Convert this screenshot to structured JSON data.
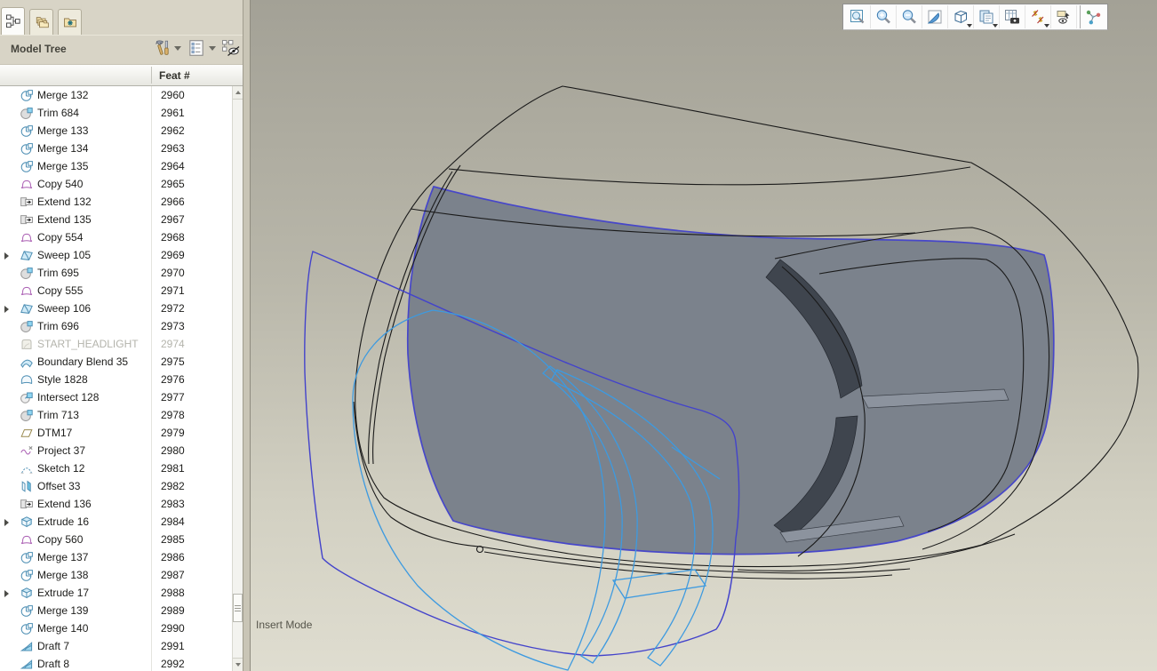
{
  "left_panel": {
    "title": "Model Tree",
    "feat_column_label": "Feat #",
    "tabs": [
      {
        "name": "model-tree",
        "icon": "model-tree-tab-icon",
        "active": true
      },
      {
        "name": "folder-browser",
        "icon": "folder-browser-icon",
        "active": false
      },
      {
        "name": "favorites",
        "icon": "favorites-folder-icon",
        "active": false
      }
    ],
    "header_tools": [
      {
        "name": "tree-filters",
        "icon": "hammer-tools-icon",
        "caret": true
      },
      {
        "name": "tree-display-options",
        "icon": "list-options-icon",
        "caret": true
      },
      {
        "name": "tree-column-settings",
        "icon": "tree-eye-icon",
        "caret": false
      }
    ],
    "rows": [
      {
        "label": "Merge 132",
        "feat": "2960",
        "icon": "merge",
        "expandable": false,
        "dim": false
      },
      {
        "label": "Trim 684",
        "feat": "2961",
        "icon": "trim",
        "expandable": false,
        "dim": false
      },
      {
        "label": "Merge 133",
        "feat": "2962",
        "icon": "merge",
        "expandable": false,
        "dim": false
      },
      {
        "label": "Merge 134",
        "feat": "2963",
        "icon": "merge",
        "expandable": false,
        "dim": false
      },
      {
        "label": "Merge 135",
        "feat": "2964",
        "icon": "merge",
        "expandable": false,
        "dim": false
      },
      {
        "label": "Copy 540",
        "feat": "2965",
        "icon": "copy",
        "expandable": false,
        "dim": false
      },
      {
        "label": "Extend 132",
        "feat": "2966",
        "icon": "extend",
        "expandable": false,
        "dim": false
      },
      {
        "label": "Extend 135",
        "feat": "2967",
        "icon": "extend",
        "expandable": false,
        "dim": false
      },
      {
        "label": "Copy 554",
        "feat": "2968",
        "icon": "copy",
        "expandable": false,
        "dim": false
      },
      {
        "label": "Sweep 105",
        "feat": "2969",
        "icon": "sweep",
        "expandable": true,
        "dim": false
      },
      {
        "label": "Trim 695",
        "feat": "2970",
        "icon": "trim",
        "expandable": false,
        "dim": false
      },
      {
        "label": "Copy 555",
        "feat": "2971",
        "icon": "copy",
        "expandable": false,
        "dim": false
      },
      {
        "label": "Sweep 106",
        "feat": "2972",
        "icon": "sweep",
        "expandable": true,
        "dim": false
      },
      {
        "label": "Trim 696",
        "feat": "2973",
        "icon": "trim",
        "expandable": false,
        "dim": false
      },
      {
        "label": "START_HEADLIGHT",
        "feat": "2974",
        "icon": "flag",
        "expandable": false,
        "dim": true
      },
      {
        "label": "Boundary Blend 35",
        "feat": "2975",
        "icon": "boundary",
        "expandable": false,
        "dim": false
      },
      {
        "label": "Style 1828",
        "feat": "2976",
        "icon": "style",
        "expandable": false,
        "dim": false
      },
      {
        "label": "Intersect 128",
        "feat": "2977",
        "icon": "intersect",
        "expandable": false,
        "dim": false
      },
      {
        "label": "Trim 713",
        "feat": "2978",
        "icon": "trim",
        "expandable": false,
        "dim": false
      },
      {
        "label": "DTM17",
        "feat": "2979",
        "icon": "dtm",
        "expandable": false,
        "dim": false
      },
      {
        "label": "Project 37",
        "feat": "2980",
        "icon": "project",
        "expandable": false,
        "dim": false
      },
      {
        "label": "Sketch 12",
        "feat": "2981",
        "icon": "sketch",
        "expandable": false,
        "dim": false
      },
      {
        "label": "Offset 33",
        "feat": "2982",
        "icon": "offset",
        "expandable": false,
        "dim": false
      },
      {
        "label": "Extend 136",
        "feat": "2983",
        "icon": "extend",
        "expandable": false,
        "dim": false
      },
      {
        "label": "Extrude 16",
        "feat": "2984",
        "icon": "extrude",
        "expandable": true,
        "dim": false
      },
      {
        "label": "Copy 560",
        "feat": "2985",
        "icon": "copy",
        "expandable": false,
        "dim": false
      },
      {
        "label": "Merge 137",
        "feat": "2986",
        "icon": "merge",
        "expandable": false,
        "dim": false
      },
      {
        "label": "Merge 138",
        "feat": "2987",
        "icon": "merge",
        "expandable": false,
        "dim": false
      },
      {
        "label": "Extrude 17",
        "feat": "2988",
        "icon": "extrude",
        "expandable": true,
        "dim": false
      },
      {
        "label": "Merge 139",
        "feat": "2989",
        "icon": "merge",
        "expandable": false,
        "dim": false
      },
      {
        "label": "Merge 140",
        "feat": "2990",
        "icon": "merge",
        "expandable": false,
        "dim": false
      },
      {
        "label": "Draft 7",
        "feat": "2991",
        "icon": "draft",
        "expandable": false,
        "dim": false
      },
      {
        "label": "Draft 8",
        "feat": "2992",
        "icon": "draft",
        "expandable": false,
        "dim": false
      }
    ]
  },
  "viewport": {
    "status_text": "Insert Mode",
    "toolbar_buttons": [
      {
        "name": "refit",
        "caret": false,
        "group_start": false
      },
      {
        "name": "zoom-in",
        "caret": false,
        "group_start": false
      },
      {
        "name": "zoom-out",
        "caret": false,
        "group_start": false
      },
      {
        "name": "repaint",
        "caret": false,
        "group_start": false
      },
      {
        "name": "display-style",
        "caret": true,
        "group_start": false
      },
      {
        "name": "saved-view-list",
        "caret": true,
        "group_start": false
      },
      {
        "name": "view-capture",
        "caret": false,
        "group_start": false
      },
      {
        "name": "datum-display",
        "caret": true,
        "group_start": false
      },
      {
        "name": "annotation-display",
        "caret": false,
        "group_start": false
      },
      {
        "name": "spin-center",
        "caret": false,
        "group_start": true
      }
    ]
  },
  "theme": {
    "chrome": "#d8d4c6",
    "viewportTop": "#a3a196",
    "viewportBottom": "#dfddd0",
    "surface": "#7b828c",
    "surfaceOutline": "#4747c9",
    "slotDark": "#3f454e",
    "slotLight": "#8c939e",
    "indigo": "#4343cb",
    "cyan": "#3d9ae0",
    "wire": "#1a1a1a"
  }
}
